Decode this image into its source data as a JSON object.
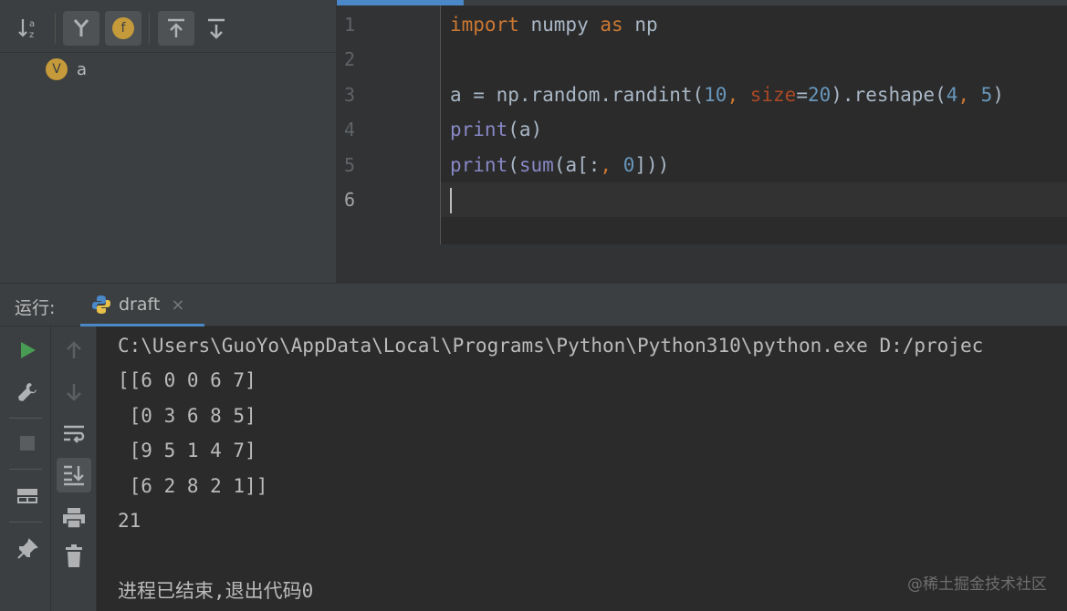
{
  "structure": {
    "toolbar": {
      "buttons": [
        {
          "icon": "sort-alpha-icon",
          "active": false
        },
        {
          "icon": "show-inherited-icon",
          "active": true
        },
        {
          "icon": "show-fields-icon",
          "active": true,
          "glyph": "f"
        },
        {
          "icon": "expand-all-icon",
          "active": true
        },
        {
          "icon": "collapse-all-icon",
          "active": false
        }
      ]
    },
    "tree": [
      {
        "badge": "V",
        "label": "a"
      }
    ]
  },
  "editor": {
    "line_numbers": [
      "1",
      "2",
      "3",
      "4",
      "5",
      "6"
    ],
    "current_line": "6",
    "lines": [
      [
        {
          "t": "import",
          "c": "kw"
        },
        {
          "t": " numpy ",
          "c": ""
        },
        {
          "t": "as",
          "c": "kw"
        },
        {
          "t": " np",
          "c": ""
        }
      ],
      [],
      [
        {
          "t": "a = np.random.randint(",
          "c": ""
        },
        {
          "t": "10",
          "c": "num"
        },
        {
          "t": ", ",
          "c": "kw"
        },
        {
          "t": "size",
          "c": "param"
        },
        {
          "t": "=",
          "c": ""
        },
        {
          "t": "20",
          "c": "num"
        },
        {
          "t": ").reshape(",
          "c": ""
        },
        {
          "t": "4",
          "c": "num"
        },
        {
          "t": ", ",
          "c": "kw"
        },
        {
          "t": "5",
          "c": "num"
        },
        {
          "t": ")",
          "c": ""
        }
      ],
      [
        {
          "t": "print",
          "c": "bi"
        },
        {
          "t": "(a)",
          "c": ""
        }
      ],
      [
        {
          "t": "print",
          "c": "bi"
        },
        {
          "t": "(",
          "c": ""
        },
        {
          "t": "sum",
          "c": "bi"
        },
        {
          "t": "(a[:",
          "c": ""
        },
        {
          "t": ", ",
          "c": "kw"
        },
        {
          "t": "0",
          "c": "num"
        },
        {
          "t": "]))",
          "c": ""
        }
      ],
      []
    ]
  },
  "run": {
    "title": "运行:",
    "tab": {
      "label": "draft",
      "close": "×"
    },
    "console": {
      "path": "C:\\Users\\GuoYo\\AppData\\Local\\Programs\\Python\\Python310\\python.exe D:/projec",
      "output": [
        "[[6 0 0 6 7]",
        " [0 3 6 8 5]",
        " [9 5 1 4 7]",
        " [6 2 8 2 1]]",
        "21"
      ],
      "exit_message": "进程已结束,退出代码0"
    }
  },
  "watermark": "@稀土掘金技术社区",
  "colors": {
    "keyword": "#cc7832",
    "number": "#6897bb",
    "builtin": "#8888c6",
    "param": "#aa4926",
    "accent": "#4a88c7",
    "run_green": "#499c54"
  }
}
